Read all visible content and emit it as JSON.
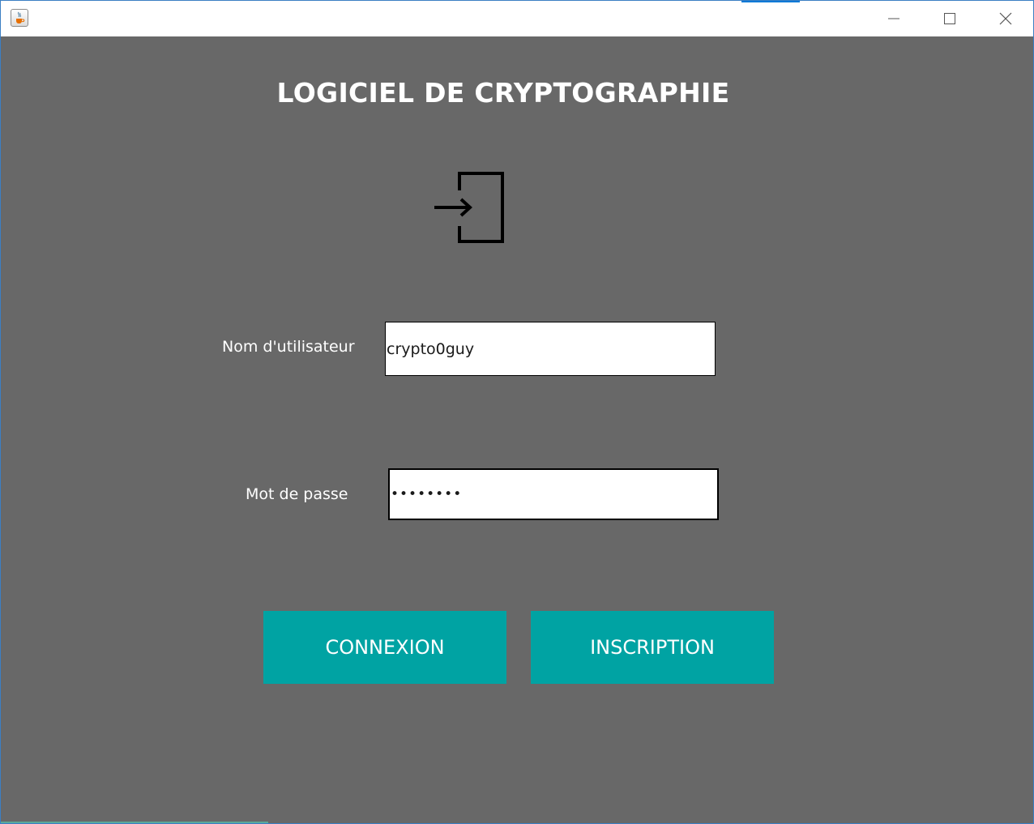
{
  "window": {
    "controls": {
      "minimize_icon": "minimize-icon",
      "maximize_icon": "maximize-icon",
      "close_icon": "close-icon"
    },
    "app_icon": "java-cup-icon"
  },
  "main": {
    "title": "LOGICIEL DE CRYPTOGRAPHIE",
    "login_icon": "login-arrow-door-icon",
    "username": {
      "label": "Nom d'utilisateur",
      "value": "crypto0guy"
    },
    "password": {
      "label": "Mot de passe",
      "value": "••••••••"
    },
    "buttons": {
      "connexion": "CONNEXION",
      "inscription": "INSCRIPTION"
    }
  },
  "colors": {
    "background": "#686868",
    "button": "#00a3a3",
    "text": "#ffffff",
    "titlebar_accent": "#0078d7"
  }
}
